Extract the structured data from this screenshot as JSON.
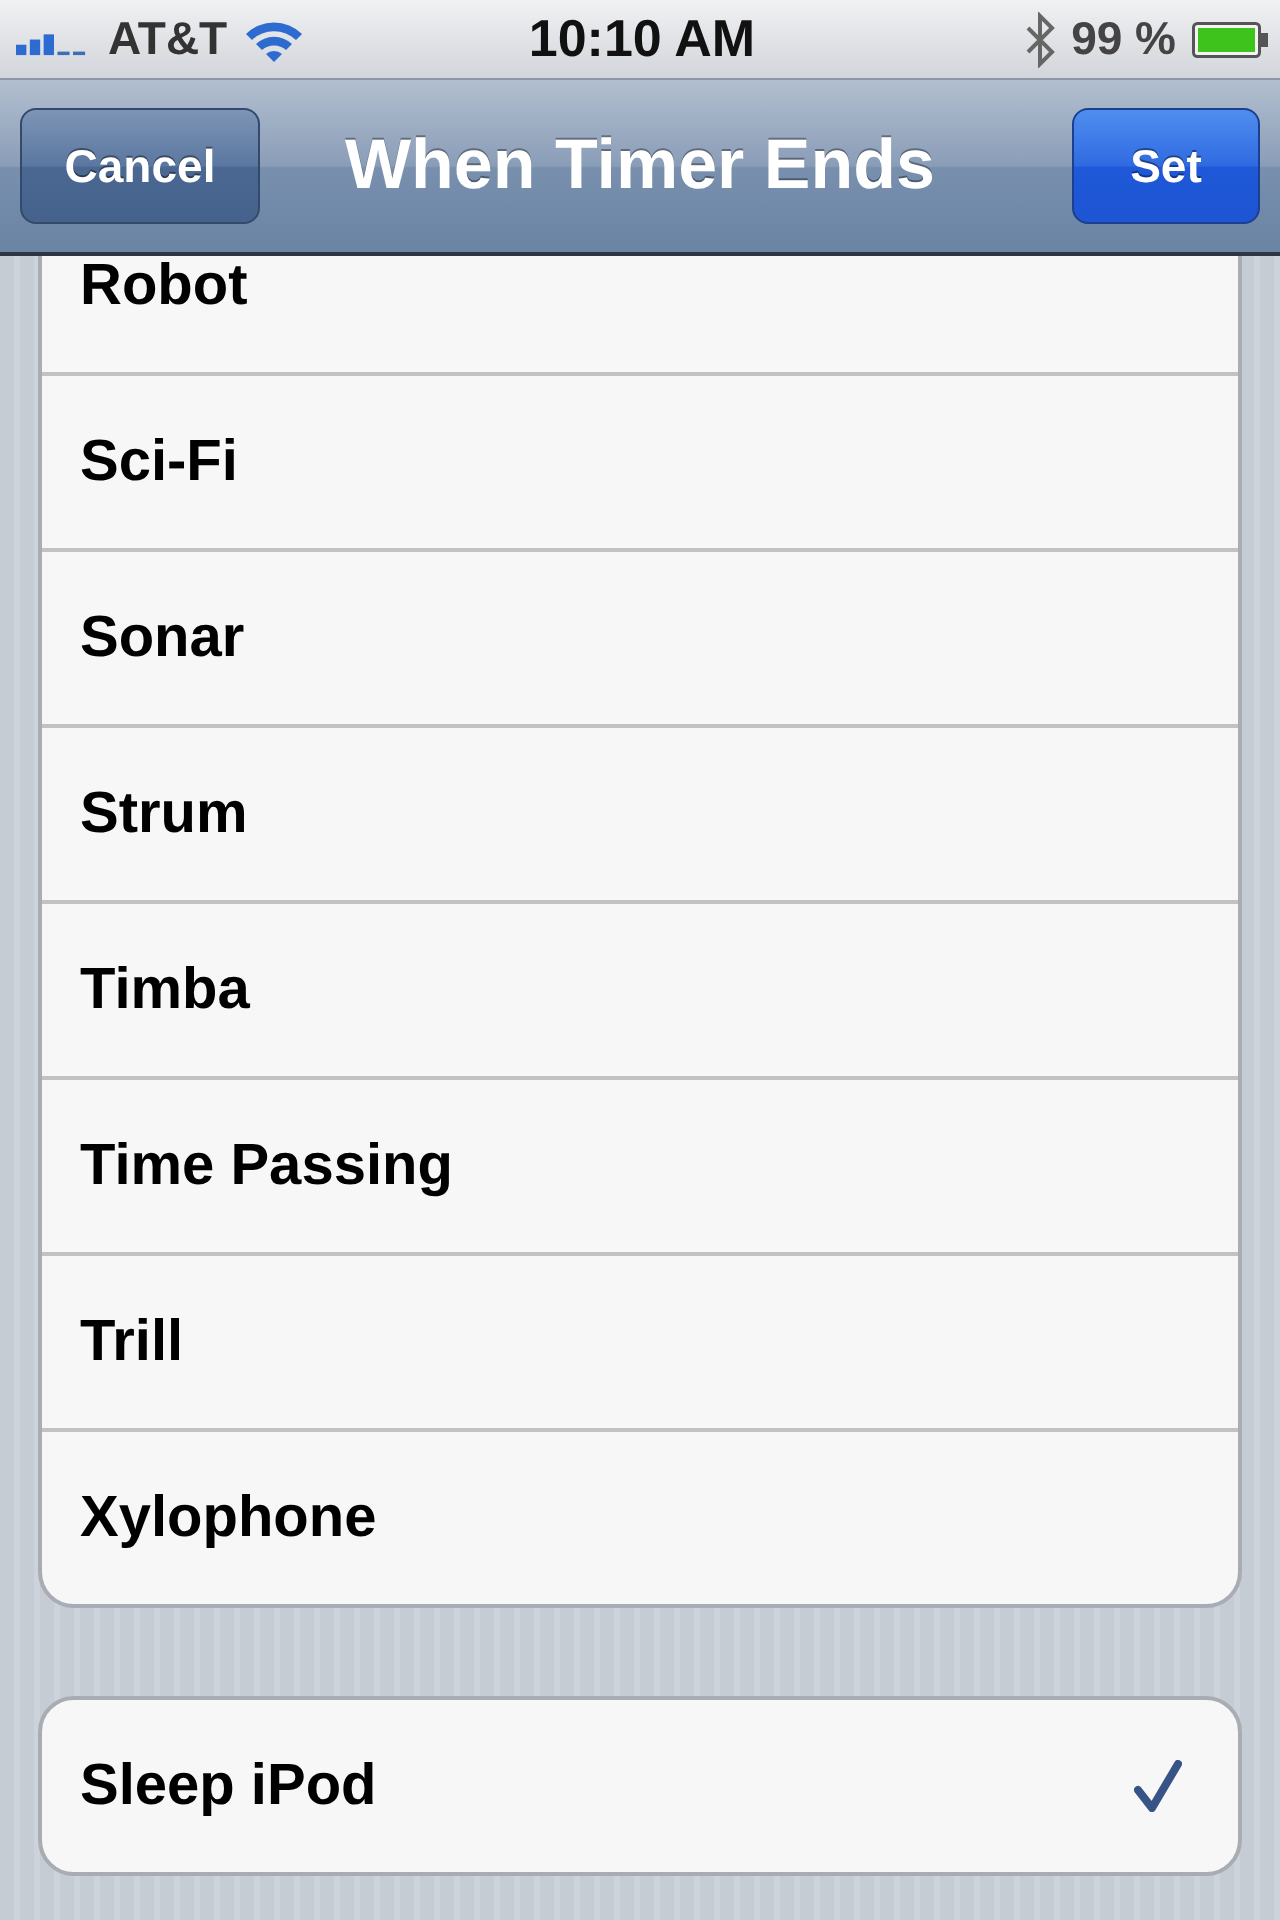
{
  "status_bar": {
    "carrier": "AT&T",
    "time": "10:10 AM",
    "battery": "99 %"
  },
  "nav_bar": {
    "left_button": "Cancel",
    "title": "When Timer Ends",
    "right_button": "Set"
  },
  "sounds": [
    {
      "label": "Robot",
      "selected": false
    },
    {
      "label": "Sci-Fi",
      "selected": false
    },
    {
      "label": "Sonar",
      "selected": false
    },
    {
      "label": "Strum",
      "selected": false
    },
    {
      "label": "Timba",
      "selected": false
    },
    {
      "label": "Time Passing",
      "selected": false
    },
    {
      "label": "Trill",
      "selected": false
    },
    {
      "label": "Xylophone",
      "selected": false
    }
  ],
  "options": [
    {
      "label": "Sleep iPod",
      "selected": true
    }
  ]
}
